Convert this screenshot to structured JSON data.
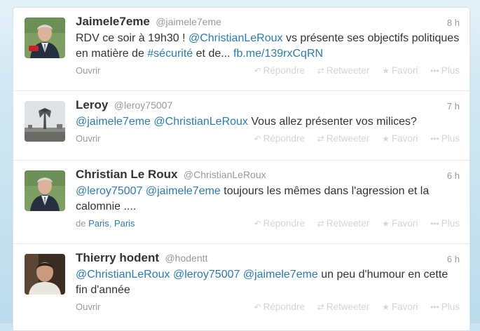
{
  "tweets": [
    {
      "fullname": "Jaimele7eme",
      "username": "@jaimele7eme",
      "time": "8 h",
      "text": [
        {
          "t": "RDV ce soir à 19h30 ! ",
          "link": false
        },
        {
          "t": "@ChristianLeRoux",
          "link": true
        },
        {
          "t": " vs présente ses objectifs politiques en matière de ",
          "link": false
        },
        {
          "t": "#sécurité",
          "link": true
        },
        {
          "t": " et de... ",
          "link": false
        },
        {
          "t": "fb.me/139rxCqRN",
          "link": true
        }
      ],
      "footer_left": "Ouvrir",
      "avatar_icon": "politician-photo"
    },
    {
      "fullname": "Leroy",
      "username": "@leroy75007",
      "time": "7 h",
      "text": [
        {
          "t": "@jaimele7eme",
          "link": true
        },
        {
          "t": " ",
          "link": false
        },
        {
          "t": "@ChristianLeRoux",
          "link": true
        },
        {
          "t": " Vous allez présenter vos milices?",
          "link": false
        }
      ],
      "footer_left": "Ouvrir",
      "avatar_icon": "monument-photo"
    },
    {
      "fullname": "Christian Le Roux",
      "username": "@ChristianLeRoux",
      "time": "6 h",
      "text": [
        {
          "t": "@leroy75007",
          "link": true
        },
        {
          "t": " ",
          "link": false
        },
        {
          "t": "@jaimele7eme",
          "link": true
        },
        {
          "t": " toujours les mêmes dans l'agression et la calomnie ....",
          "link": false
        }
      ],
      "footer_left_parts": [
        "de ",
        "Paris",
        ", ",
        "Paris"
      ],
      "avatar_icon": "politician-photo"
    },
    {
      "fullname": "Thierry hodent",
      "username": "@hodentt",
      "time": "6 h",
      "text": [
        {
          "t": "@ChristianLeRoux",
          "link": true
        },
        {
          "t": " ",
          "link": false
        },
        {
          "t": "@leroy75007",
          "link": true
        },
        {
          "t": " ",
          "link": false
        },
        {
          "t": "@jaimele7eme",
          "link": true
        },
        {
          "t": " un peu d'humour en cette fin d'année",
          "link": false
        }
      ],
      "footer_left": "Ouvrir",
      "avatar_icon": "man-photo"
    }
  ],
  "actions": {
    "reply": "Répondre",
    "retweet": "Retweeter",
    "favorite": "Favori",
    "more": "Plus"
  },
  "colors": {
    "link": "#2a7bb6",
    "text": "#333333",
    "muted": "#999999",
    "action": "#d2d6d9"
  }
}
